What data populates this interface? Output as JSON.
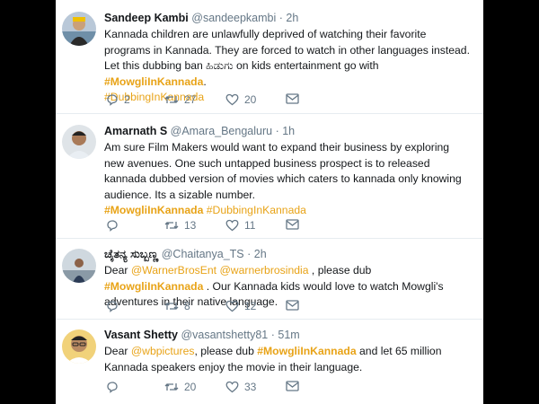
{
  "tweets": [
    {
      "name": "Sandeep Kambi",
      "handle": "@sandeepkambi",
      "dot": "·",
      "time": "2h",
      "text1": "Kannada children are unlawfully deprived of watching their favorite programs in Kannada. They are forced to watch in other languages instead. Let this dubbing ban ಹಿಡುಗು on kids entertainment go with ",
      "tag1": "#MowgliInKannada",
      "text2": ".",
      "line_break_tag": "#DubbingInKannada",
      "replies": "2",
      "retweets": "27",
      "likes": "20"
    },
    {
      "name": "Amarnath S",
      "handle": "@Amara_Bengaluru",
      "dot": "·",
      "time": "1h",
      "text1": "Am sure Film Makers would want to expand their business by exploring new avenues. One such untapped business prospect is to released kannada dubbed version of movies which caters to kannada only knowing audience. Its a sizable number.",
      "tag1": "#MowgliInKannada",
      "tag2": "#DubbingInKannada",
      "replies": "",
      "retweets": "13",
      "likes": "11"
    },
    {
      "name": "ಚೈತನ್ಯ ಸುಬ್ಬಣ್ಣ",
      "handle": "@Chaitanya_TS",
      "dot": "·",
      "time": "2h",
      "pre": "Dear ",
      "mention1": "@WarnerBrosEnt",
      "mention2": "@warnerbrosindia",
      "mid": " , please dub ",
      "tag1": "#MowgliInKannada",
      "text2": " . Our Kannada kids would love to watch Mowgli's adventures in their native language.",
      "replies": "",
      "retweets": "8",
      "likes": "12"
    },
    {
      "name": "Vasant Shetty",
      "handle": "@vasantshetty81",
      "dot": "·",
      "time": "51m",
      "pre": "Dear ",
      "mention1": "@wbpictures",
      "mid": ", please dub ",
      "tag1": "#MowgliInKannada",
      "text2": " and let 65 million Kannada speakers enjoy the movie in their language.",
      "replies": "",
      "retweets": "20",
      "likes": "33"
    }
  ],
  "colors": {
    "hashtag": "#e8a317",
    "meta": "#657786",
    "text": "#14171a"
  },
  "icons": [
    "reply-icon",
    "retweet-icon",
    "like-icon",
    "mail-icon"
  ]
}
